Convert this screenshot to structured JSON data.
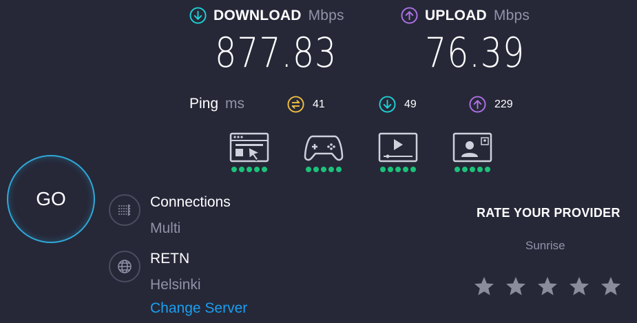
{
  "download": {
    "label": "DOWNLOAD",
    "unit": "Mbps",
    "value": "877.83",
    "icon": "arrow-down-circle-icon",
    "color": "#1dd2d6"
  },
  "upload": {
    "label": "UPLOAD",
    "unit": "Mbps",
    "value": "76.39",
    "icon": "arrow-up-circle-icon",
    "color": "#b072e8"
  },
  "ping": {
    "label": "Ping",
    "unit": "ms",
    "idle": {
      "value": "41",
      "icon": "ping-idle-icon",
      "color": "#f0c040"
    },
    "download": {
      "value": "49",
      "icon": "ping-download-icon",
      "color": "#1dd2d6"
    },
    "upload": {
      "value": "229",
      "icon": "ping-upload-icon",
      "color": "#b072e8"
    }
  },
  "experience": [
    {
      "icon": "web-browsing-icon",
      "rating": 5
    },
    {
      "icon": "gaming-icon",
      "rating": 5
    },
    {
      "icon": "video-streaming-icon",
      "rating": 5
    },
    {
      "icon": "video-call-icon",
      "rating": 5
    }
  ],
  "go_button": {
    "label": "GO"
  },
  "connections": {
    "title": "Connections",
    "value": "Multi",
    "icon": "connections-icon"
  },
  "server": {
    "title": "RETN",
    "location": "Helsinki",
    "change_label": "Change Server",
    "icon": "globe-icon"
  },
  "rate": {
    "title": "RATE YOUR PROVIDER",
    "provider": "Sunrise",
    "stars": 5,
    "rating": 0
  },
  "colors": {
    "background": "#262838",
    "accent": "#1a9ff0",
    "good": "#1cc27a",
    "muted": "#9193a8"
  }
}
